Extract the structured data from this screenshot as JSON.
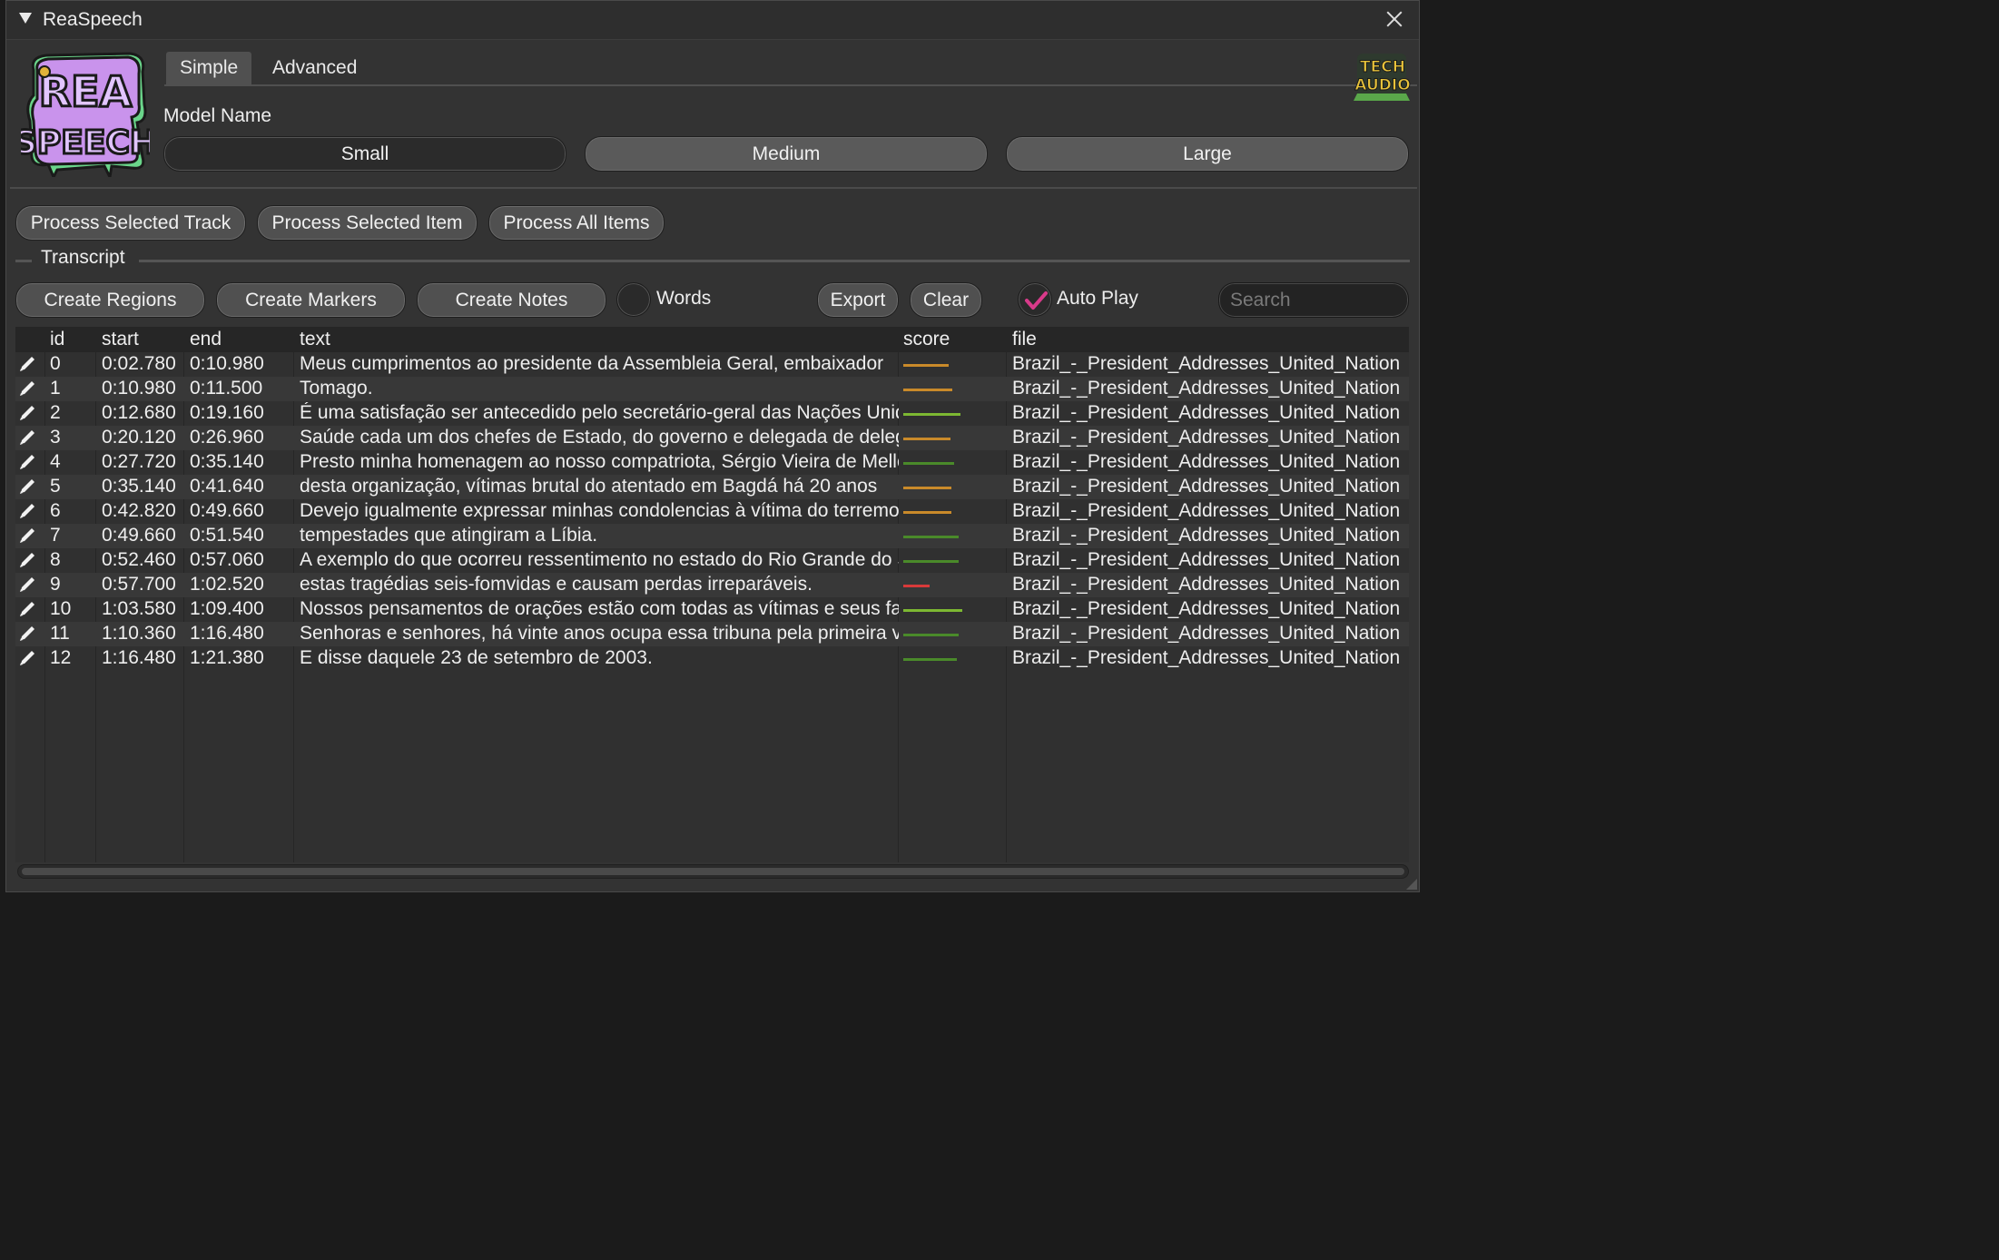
{
  "window": {
    "title": "ReaSpeech"
  },
  "logos": {
    "main_logo": "REA SPEECH",
    "corner_logo": "TECH AUDIO"
  },
  "tabs": [
    {
      "label": "Simple",
      "selected": true
    },
    {
      "label": "Advanced",
      "selected": false
    }
  ],
  "model": {
    "label": "Model Name",
    "options": [
      "Small",
      "Medium",
      "Large"
    ],
    "selected": "Small"
  },
  "process": {
    "selected_track": "Process Selected Track",
    "selected_item": "Process Selected Item",
    "all_items": "Process All Items"
  },
  "transcript": {
    "label": "Transcript",
    "create_regions": "Create Regions",
    "create_markers": "Create Markers",
    "create_notes": "Create Notes",
    "words_label": "Words",
    "words_checked": false,
    "export": "Export",
    "clear": "Clear",
    "autoplay_label": "Auto Play",
    "autoplay_checked": true,
    "search_placeholder": "Search"
  },
  "colors": {
    "score_high": "#7db832",
    "score_mid_green": "#4a8a2a",
    "score_orange": "#c98a2a",
    "score_red": "#d83a3a",
    "check": "#d83a8a"
  },
  "table": {
    "columns": [
      "id",
      "start",
      "end",
      "text",
      "score",
      "file"
    ],
    "rows": [
      {
        "id": "0",
        "start": "0:02.780",
        "end": "0:10.980",
        "text": "Meus cumprimentos ao presidente da Assembleia Geral, embaixador",
        "score": 0.7,
        "score_color": "#c98a2a",
        "file": "Brazil_-_President_Addresses_United_Nation"
      },
      {
        "id": "1",
        "start": "0:10.980",
        "end": "0:11.500",
        "text": "Tomago.",
        "score": 0.75,
        "score_color": "#c98a2a",
        "file": "Brazil_-_President_Addresses_United_Nation"
      },
      {
        "id": "2",
        "start": "0:12.680",
        "end": "0:19.160",
        "text": "É uma satisfação ser antecedido pelo secretário-geral das Nações Unidas",
        "score": 0.88,
        "score_color": "#7db832",
        "file": "Brazil_-_President_Addresses_United_Nation"
      },
      {
        "id": "3",
        "start": "0:20.120",
        "end": "0:26.960",
        "text": "Saúde cada um dos chefes de Estado, do governo e delegada de delegação",
        "score": 0.72,
        "score_color": "#c98a2a",
        "file": "Brazil_-_President_Addresses_United_Nation"
      },
      {
        "id": "4",
        "start": "0:27.720",
        "end": "0:35.140",
        "text": "Presto minha homenagem ao nosso compatriota, Sérgio Vieira de Mello",
        "score": 0.78,
        "score_color": "#4a8a2a",
        "file": "Brazil_-_President_Addresses_United_Nation"
      },
      {
        "id": "5",
        "start": "0:35.140",
        "end": "0:41.640",
        "text": "desta organização, vítimas brutal do atentado em Bagdá há 20 anos",
        "score": 0.73,
        "score_color": "#c98a2a",
        "file": "Brazil_-_President_Addresses_United_Nation"
      },
      {
        "id": "6",
        "start": "0:42.820",
        "end": "0:49.660",
        "text": "Devejo igualmente expressar minhas condolencias à vítima do terremoto",
        "score": 0.73,
        "score_color": "#c98a2a",
        "file": "Brazil_-_President_Addresses_United_Nation"
      },
      {
        "id": "7",
        "start": "0:49.660",
        "end": "0:51.540",
        "text": "tempestades que atingiram a Líbia.",
        "score": 0.85,
        "score_color": "#4a8a2a",
        "file": "Brazil_-_President_Addresses_United_Nation"
      },
      {
        "id": "8",
        "start": "0:52.460",
        "end": "0:57.060",
        "text": "A exemplo do que ocorreu ressentimento no estado do Rio Grande do Sul",
        "score": 0.85,
        "score_color": "#4a8a2a",
        "file": "Brazil_-_President_Addresses_United_Nation"
      },
      {
        "id": "9",
        "start": "0:57.700",
        "end": "1:02.520",
        "text": "estas tragédias seis-fomvidas e causam perdas irreparáveis.",
        "score": 0.4,
        "score_color": "#d83a3a",
        "file": "Brazil_-_President_Addresses_United_Nation"
      },
      {
        "id": "10",
        "start": "1:03.580",
        "end": "1:09.400",
        "text": "Nossos pensamentos de orações estão com todas as vítimas e seus familiares",
        "score": 0.9,
        "score_color": "#7db832",
        "file": "Brazil_-_President_Addresses_United_Nation"
      },
      {
        "id": "11",
        "start": "1:10.360",
        "end": "1:16.480",
        "text": "Senhoras e senhores, há vinte anos ocupa essa tribuna pela primeira vez",
        "score": 0.85,
        "score_color": "#4a8a2a",
        "file": "Brazil_-_President_Addresses_United_Nation"
      },
      {
        "id": "12",
        "start": "1:16.480",
        "end": "1:21.380",
        "text": "E disse daquele 23 de setembro de 2003.",
        "score": 0.82,
        "score_color": "#4a8a2a",
        "file": "Brazil_-_President_Addresses_United_Nation"
      }
    ]
  }
}
